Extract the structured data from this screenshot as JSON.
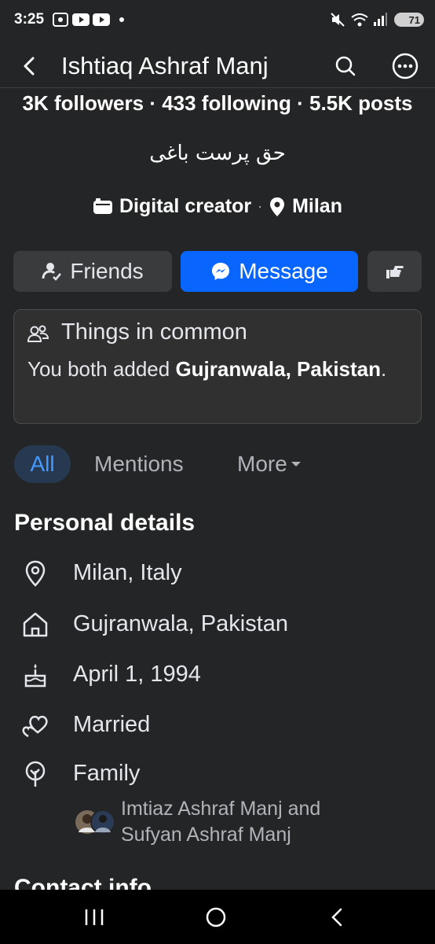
{
  "status_bar": {
    "time": "3:25",
    "battery": "71"
  },
  "header": {
    "title": "Ishtiaq Ashraf Manj"
  },
  "profile": {
    "stats": "3K followers · 433 following · 5.5K posts",
    "bio": "حق پرست باغی",
    "category": "Digital creator",
    "separator": "·",
    "location": "Milan"
  },
  "actions": {
    "friends_label": "Friends",
    "message_label": "Message"
  },
  "common": {
    "title": "Things in common",
    "body_prefix": "You both added ",
    "body_bold": "Gujranwala, Pakistan",
    "body_suffix": "."
  },
  "tabs": {
    "all": "All",
    "mentions": "Mentions",
    "more": "More"
  },
  "personal": {
    "title": "Personal details",
    "current_city": "Milan, Italy",
    "hometown": "Gujranwala, Pakistan",
    "birthday": "April 1, 1994",
    "relationship": "Married",
    "family_label": "Family",
    "family_line1": "Imtiaz Ashraf Manj and",
    "family_line2": "Sufyan Ashraf Manj"
  },
  "contact": {
    "title": "Contact info"
  },
  "colors": {
    "background": "#242526",
    "accent": "#0866ff",
    "tab_active_bg": "#263951",
    "tab_active_text": "#4599ff"
  }
}
